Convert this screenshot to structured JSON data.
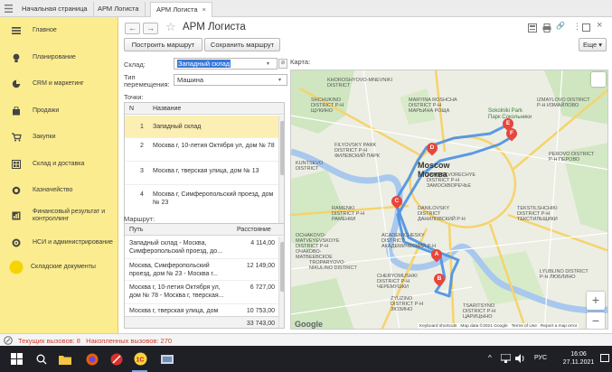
{
  "tabs": [
    {
      "label": "Начальная страница"
    },
    {
      "label": "АРМ Логиста"
    },
    {
      "label": "АРМ Логиста",
      "close": "×"
    }
  ],
  "sidebar": {
    "items": [
      {
        "label": "Главное",
        "icon": "menu-icon"
      },
      {
        "label": "Планирование",
        "icon": "lightbulb-icon"
      },
      {
        "label": "CRM и маркетинг",
        "icon": "pie-chart-icon"
      },
      {
        "label": "Продажи",
        "icon": "shopping-bag-icon"
      },
      {
        "label": "Закупки",
        "icon": "cart-icon"
      },
      {
        "label": "Склад и доставка",
        "icon": "warehouse-icon"
      },
      {
        "label": "Казначейство",
        "icon": "coins-icon"
      },
      {
        "label": "Финансовый результат и контроллинг",
        "icon": "analytics-icon"
      },
      {
        "label": "НСИ и администрирование",
        "icon": "settings-icon"
      },
      {
        "label": "Складские документы",
        "icon": "circle-icon"
      }
    ]
  },
  "header": {
    "title": "АРМ Логиста",
    "back": "←",
    "forward": "→",
    "star": "☆",
    "more_label": "Еще",
    "more_arrow": "▾",
    "link": "🔗",
    "help": "?",
    "close": "×",
    "window_menu": "⋮"
  },
  "toolbar": {
    "build_route": "Построить маршрут",
    "save_route": "Сохранить маршрут"
  },
  "form": {
    "warehouse_label": "Склад:",
    "warehouse_value": "Западный склад",
    "move_type_label": "Тип перемещения:",
    "move_type_value": "Машина",
    "points_label": "Точки:",
    "map_label": "Карта:",
    "route_label": "Маршрут:"
  },
  "points": {
    "headers": [
      "N",
      "Название"
    ],
    "rows": [
      {
        "n": "1",
        "name": "Западный склад"
      },
      {
        "n": "2",
        "name": "Москва г, 10-летия Октября ул, дом № 78"
      },
      {
        "n": "3",
        "name": "Москва г, тверская улица, дом № 13"
      },
      {
        "n": "4",
        "name": "Москва г, Симферопольский проезд, дом № 23"
      }
    ]
  },
  "route": {
    "headers": [
      "Путь",
      "Расстояние"
    ],
    "rows": [
      {
        "path": "Западный склад - Москва, Симферопольский проезд, до...",
        "distance": "4 114,00"
      },
      {
        "path": "Москва, Симферопольский проезд, дом № 23 - Москва г...",
        "distance": "12 149,00"
      },
      {
        "path": "Москва г, 10-летия Октября ул, дом № 78 - Москва г, тверская...",
        "distance": "6 727,00"
      },
      {
        "path": "Москва г, тверская улица, дом",
        "distance": "10 753,00"
      }
    ],
    "total": "33 743,00"
  },
  "map": {
    "city_en": "Moscow",
    "city_ru": "Москва",
    "park_en": "Sokolniki Park",
    "park_ru": "Парк Сокольники",
    "districts": [
      "SHCHUKINO DISTRICT Р-Н ЩУКИНО",
      "MARYINA ROSHCHA DISTRICT Р-Н МАРЬИНА РОЩА",
      "IZMAYLOVO DISTRICT Р-Н ИЗМАЙЛОВО",
      "FILYOVSKY PARK DISTRICT Р-Н ФИЛЕВСКИЙ ПАРК",
      "ZAMOSKVORECHYE DISTRICT Р-Н ЗАМОСКВОРЕЧЬЕ",
      "PEROVO DISTRICT Р-Н ПЕРОВО",
      "RAMENKI DISTRICT Р-Н РАМЕНКИ",
      "DANILOVSKY DISTRICT ДАНИЛОВСКИЙ Р-Н",
      "TEKSTILSHCHIKI DISTRICT Р-Н ТЕКСТИЛЬЩИКИ",
      "ACADEMICHESKY DISTRICT АКАДЕМИЧЕСКИЙ Р-Н",
      "OCHAKOVO-MATVEYEVSKOYE DISTRICT Р-Н ОЧАКОВО-МАТВЕЕВСКОЕ",
      "CHERYOMUSHKI DISTRICT Р-Н ЧЕРЕМУШКИ",
      "LYUBLINO DISTRICT Р-Н ЛЮБЛИНО",
      "TSARITSYNO DISTRICT Р-Н ЦАРИЦЫНО",
      "KUNTSEVO DISTRICT",
      "KHOROSHYOVO-MNEVNIKI DISTRICT",
      "ZYUZINO DISTRICT Р-Н ЗЮЗИНО",
      "TROPARYOVO-NIKULINO DISTRICT"
    ],
    "pins": [
      "A",
      "B",
      "C",
      "D",
      "E",
      "F"
    ],
    "google": "Google",
    "attribution": [
      "Keyboard shortcuts",
      "Map data ©2021 Google",
      "Terms of Use",
      "Report a map error"
    ],
    "zoom_in": "+",
    "zoom_out": "−"
  },
  "statusbar": {
    "text": "Текущих вызовов: 8   Накопленных вызовов: 270"
  },
  "taskbar": {
    "time": "16:06",
    "date": "27.11.2021",
    "lang": "РУС"
  },
  "colors": {
    "sidebar_bg": "#fbec8f",
    "selected_row": "#fcefb4",
    "route_line": "#4a90e2",
    "pin": "#e8453c",
    "status_text": "#d23c2c"
  }
}
